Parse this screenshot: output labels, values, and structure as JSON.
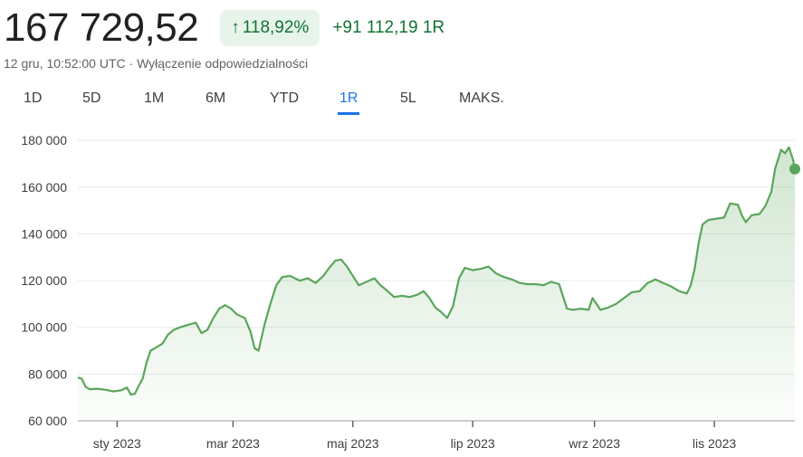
{
  "quote": {
    "price": "167 729,52",
    "change_percent": "118,92%",
    "change_arrow": "↑",
    "change_abs": "+91 112,19 1R",
    "timestamp": "12 gru, 10:52:00 UTC",
    "separator": " · ",
    "disclaimer": "Wyłączenie odpowiedzialności"
  },
  "tabs": [
    {
      "label": "1D",
      "active": false
    },
    {
      "label": "5D",
      "active": false
    },
    {
      "label": "1M",
      "active": false
    },
    {
      "label": "6M",
      "active": false
    },
    {
      "label": "YTD",
      "active": false
    },
    {
      "label": "1R",
      "active": true
    },
    {
      "label": "5L",
      "active": false
    },
    {
      "label": "MAKS.",
      "active": false
    }
  ],
  "colors": {
    "line": "#5ba55b",
    "positive": "#137333",
    "badge_bg": "#e6f4ea",
    "accent": "#1a73e8",
    "grid": "#e8eaed"
  },
  "chart_data": {
    "type": "area",
    "title": "",
    "xlabel": "",
    "ylabel": "",
    "ylim": [
      60000,
      182000
    ],
    "yticks": [
      60000,
      80000,
      100000,
      120000,
      140000,
      160000,
      180000
    ],
    "ytick_labels": [
      "60 000",
      "80 000",
      "100 000",
      "120 000",
      "140 000",
      "160 000",
      "180 000"
    ],
    "xticks": [
      {
        "date": "2023-01-01",
        "label": "sty 2023"
      },
      {
        "date": "2023-03-01",
        "label": "mar 2023"
      },
      {
        "date": "2023-05-01",
        "label": "maj 2023"
      },
      {
        "date": "2023-07-01",
        "label": "lip 2023"
      },
      {
        "date": "2023-09-01",
        "label": "wrz 2023"
      },
      {
        "date": "2023-11-01",
        "label": "lis 2023"
      }
    ],
    "x_range": [
      "2022-12-12",
      "2023-12-12"
    ],
    "grid": true,
    "series": [
      {
        "values": [
          [
            "2022-12-12",
            78500
          ],
          [
            "2022-12-14",
            78000
          ],
          [
            "2022-12-16",
            74500
          ],
          [
            "2022-12-18",
            73500
          ],
          [
            "2022-12-22",
            73700
          ],
          [
            "2022-12-26",
            73300
          ],
          [
            "2022-12-30",
            72600
          ],
          [
            "2023-01-03",
            73000
          ],
          [
            "2023-01-06",
            74200
          ],
          [
            "2023-01-08",
            71200
          ],
          [
            "2023-01-10",
            71500
          ],
          [
            "2023-01-12",
            75000
          ],
          [
            "2023-01-14",
            78000
          ],
          [
            "2023-01-16",
            85000
          ],
          [
            "2023-01-18",
            90000
          ],
          [
            "2023-01-21",
            91500
          ],
          [
            "2023-01-24",
            93000
          ],
          [
            "2023-01-27",
            97000
          ],
          [
            "2023-01-30",
            99000
          ],
          [
            "2023-02-02",
            100000
          ],
          [
            "2023-02-06",
            101000
          ],
          [
            "2023-02-10",
            102000
          ],
          [
            "2023-02-13",
            97500
          ],
          [
            "2023-02-16",
            99000
          ],
          [
            "2023-02-19",
            104000
          ],
          [
            "2023-02-22",
            108000
          ],
          [
            "2023-02-25",
            109500
          ],
          [
            "2023-02-28",
            108000
          ],
          [
            "2023-03-03",
            105500
          ],
          [
            "2023-03-07",
            104000
          ],
          [
            "2023-03-10",
            98000
          ],
          [
            "2023-03-12",
            91000
          ],
          [
            "2023-03-14",
            90000
          ],
          [
            "2023-03-17",
            101000
          ],
          [
            "2023-03-20",
            110000
          ],
          [
            "2023-03-23",
            118000
          ],
          [
            "2023-03-26",
            121500
          ],
          [
            "2023-03-30",
            122000
          ],
          [
            "2023-04-04",
            120000
          ],
          [
            "2023-04-08",
            121000
          ],
          [
            "2023-04-12",
            119000
          ],
          [
            "2023-04-16",
            122000
          ],
          [
            "2023-04-19",
            125500
          ],
          [
            "2023-04-22",
            128500
          ],
          [
            "2023-04-25",
            129000
          ],
          [
            "2023-04-28",
            126000
          ],
          [
            "2023-05-01",
            122000
          ],
          [
            "2023-05-04",
            118000
          ],
          [
            "2023-05-08",
            119500
          ],
          [
            "2023-05-12",
            121000
          ],
          [
            "2023-05-15",
            118000
          ],
          [
            "2023-05-18",
            116000
          ],
          [
            "2023-05-22",
            113000
          ],
          [
            "2023-05-26",
            113500
          ],
          [
            "2023-05-30",
            113000
          ],
          [
            "2023-06-03",
            114000
          ],
          [
            "2023-06-06",
            115500
          ],
          [
            "2023-06-09",
            112500
          ],
          [
            "2023-06-12",
            108500
          ],
          [
            "2023-06-15",
            106500
          ],
          [
            "2023-06-18",
            104000
          ],
          [
            "2023-06-21",
            109000
          ],
          [
            "2023-06-24",
            121000
          ],
          [
            "2023-06-27",
            125500
          ],
          [
            "2023-07-01",
            124500
          ],
          [
            "2023-07-05",
            125000
          ],
          [
            "2023-07-09",
            126000
          ],
          [
            "2023-07-13",
            123000
          ],
          [
            "2023-07-17",
            121500
          ],
          [
            "2023-07-21",
            120500
          ],
          [
            "2023-07-25",
            119000
          ],
          [
            "2023-07-29",
            118500
          ],
          [
            "2023-08-02",
            118500
          ],
          [
            "2023-08-06",
            118000
          ],
          [
            "2023-08-10",
            119500
          ],
          [
            "2023-08-14",
            118500
          ],
          [
            "2023-08-18",
            108000
          ],
          [
            "2023-08-21",
            107500
          ],
          [
            "2023-08-25",
            108000
          ],
          [
            "2023-08-29",
            107500
          ],
          [
            "2023-08-31",
            112500
          ],
          [
            "2023-09-04",
            107500
          ],
          [
            "2023-09-08",
            108500
          ],
          [
            "2023-09-12",
            110000
          ],
          [
            "2023-09-16",
            112500
          ],
          [
            "2023-09-20",
            115000
          ],
          [
            "2023-09-24",
            115500
          ],
          [
            "2023-09-28",
            119000
          ],
          [
            "2023-10-02",
            120500
          ],
          [
            "2023-10-06",
            119000
          ],
          [
            "2023-10-10",
            117500
          ],
          [
            "2023-10-14",
            115500
          ],
          [
            "2023-10-18",
            114500
          ],
          [
            "2023-10-20",
            118000
          ],
          [
            "2023-10-22",
            125000
          ],
          [
            "2023-10-24",
            136000
          ],
          [
            "2023-10-26",
            144000
          ],
          [
            "2023-10-29",
            146000
          ],
          [
            "2023-11-02",
            146500
          ],
          [
            "2023-11-06",
            147000
          ],
          [
            "2023-11-09",
            153000
          ],
          [
            "2023-11-13",
            152500
          ],
          [
            "2023-11-15",
            148000
          ],
          [
            "2023-11-17",
            145000
          ],
          [
            "2023-11-20",
            148000
          ],
          [
            "2023-11-24",
            148500
          ],
          [
            "2023-11-27",
            152000
          ],
          [
            "2023-11-30",
            158000
          ],
          [
            "2023-12-02",
            168000
          ],
          [
            "2023-12-05",
            176000
          ],
          [
            "2023-12-07",
            174500
          ],
          [
            "2023-12-09",
            177000
          ],
          [
            "2023-12-11",
            172000
          ],
          [
            "2023-12-12",
            167729.52
          ]
        ]
      }
    ]
  }
}
